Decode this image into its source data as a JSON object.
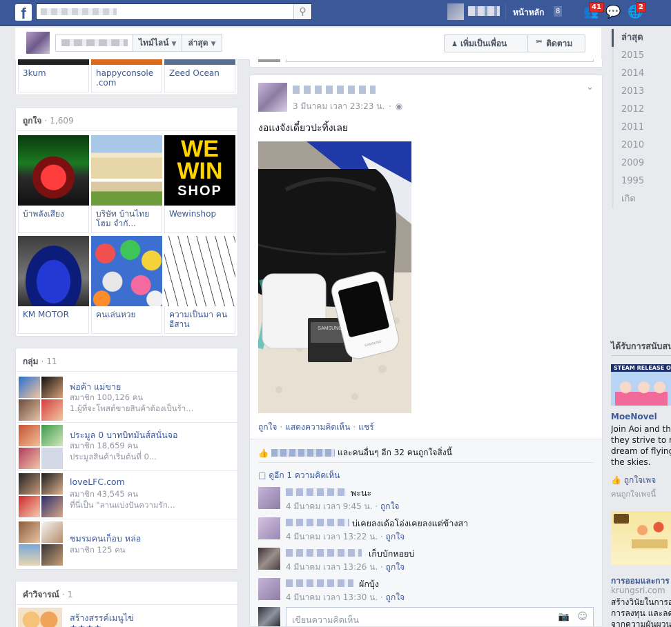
{
  "topbar": {
    "logo": "f",
    "home_label": "หน้าหลัก",
    "home_count": "8",
    "friend_requests_badge": "41",
    "notifications_badge": "2",
    "search_icon": "search-icon"
  },
  "cover": {
    "timeline_label": "ไทม์ไลน์",
    "recent_label": "ล่าสุด",
    "add_friend_label": "เพิ่มเป็นเพื่อน",
    "follow_label": "ติดตาม"
  },
  "friends_strip": {
    "items": [
      "3kum",
      "happyconsole .com",
      "Zeed Ocean"
    ]
  },
  "likes": {
    "title": "ถูกใจ",
    "count": "1,609",
    "items": [
      "บ้าพลังเสียง",
      "บริษัท บ้านไทยโฮม จำกั...",
      "Wewinshop",
      "KM MOTOR",
      "คนเล่นหวย",
      "ความเป็นมา คนอีสาน"
    ],
    "wewin_text": [
      "WE",
      "WIN",
      "SHOP"
    ]
  },
  "groups": {
    "title": "กลุ่ม",
    "count": "11",
    "items": [
      {
        "name": "พ่อค้า แม่ขาย",
        "members": "สมาชิก 100,126 คน",
        "desc": "1.ผู้ที่จะโพสต์ขายสินค้าต้องเป็นร้า..."
      },
      {
        "name": "ประมูล 0 บาทบิทมันส์สนั่นจอ",
        "members": "สมาชิก 18,659 คน",
        "desc": "ประมูลสินค้าเริ่มต้นที่ 0..."
      },
      {
        "name": "loveLFC.com",
        "members": "สมาชิก 43,545 คน",
        "desc": "ที่นี่เป็น \"ลานแบ่งปันความรัก..."
      },
      {
        "name": "ชมรมคนเก็อบ หล่อ",
        "members": "สมาชิก 125 คน",
        "desc": ""
      }
    ]
  },
  "reviews": {
    "title": "คำวิจารณ์",
    "count": "1",
    "item": "สร้างสรรค์เมนูไข่",
    "stars": "★★★★"
  },
  "post": {
    "time": "3 มีนาคม เวลา 23:23 น.",
    "text": "งอแงจังเดี๋ยวปะทิ้งเลย",
    "like_action": "ถูกใจ",
    "comment_action": "แสดงความคิดเห็น",
    "share_action": "แชร์",
    "likes_text": "และคนอื่นๆ อีก 32 คนถูกใจสิ่งนี้",
    "more_comments": "ดูอีก 1 ความคิดเห็น",
    "comments": [
      {
        "text": "พะนะ",
        "time": "4 มีนาคม เวลา 9:45 น.",
        "like": "ถูกใจ"
      },
      {
        "text": "บ่เคยลงเด้อโอ่งเคยลงแต่ข้างสา",
        "time": "4 มีนาคม เวลา 13:22 น.",
        "like": "ถูกใจ"
      },
      {
        "text": "เก็บบักหอยบ่",
        "time": "4 มีนาคม เวลา 13:26 น.",
        "like": "ถูกใจ"
      },
      {
        "text": "ผักบุ้ง",
        "time": "4 มีนาคม เวลา 13:30 น.",
        "like": "ถูกใจ"
      }
    ],
    "reply_placeholder": "เขียนความคิดเห็น",
    "battery_brand": "SAMSUNG",
    "phone_brand": "SAMSUNG"
  },
  "timeline_years": [
    "ล่าสุด",
    "2015",
    "2014",
    "2013",
    "2012",
    "2011",
    "2010",
    "2009",
    "1995",
    "เกิด"
  ],
  "ads": {
    "heading": "ได้รับการสนับสนุน",
    "ad1": {
      "banner": "STEAM RELEASE OFFICIAL",
      "title": "MoeNovel",
      "text": [
        "Join Aoi and the",
        "they strive to re",
        "dream of flying",
        "the skies."
      ],
      "like": "ถูกใจเพจ",
      "meta": "คนถูกใจเพจนี้"
    },
    "ad2": {
      "title": "การออมและการ",
      "url": "krungsri.com",
      "text": [
        "สร้างวินัยในการออ",
        "การลงทุน และลด",
        "จากความผันผวน"
      ]
    }
  }
}
